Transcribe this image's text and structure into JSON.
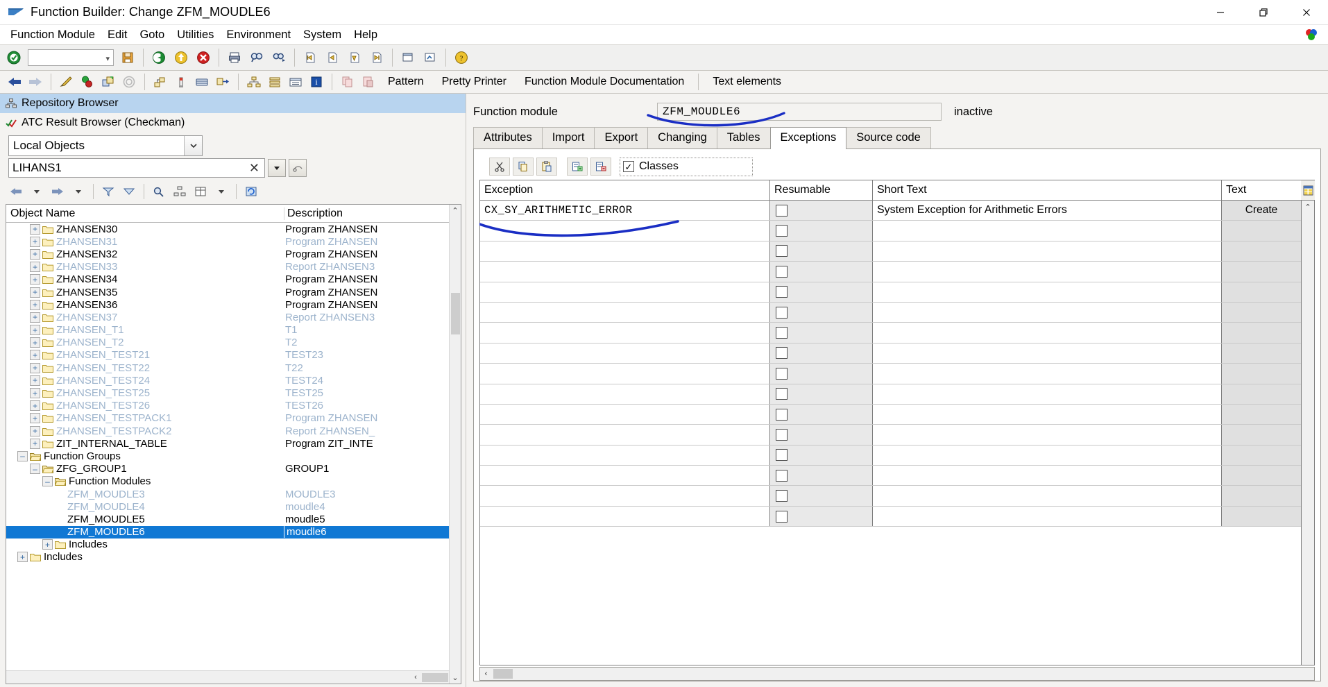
{
  "window": {
    "title": "Function Builder: Change ZFM_MOUDLE6",
    "controls": {
      "minimize": "—",
      "restore": "❐",
      "close": "✕"
    }
  },
  "menubar": {
    "items": [
      {
        "label": "Function Module"
      },
      {
        "label": "Edit"
      },
      {
        "label": "Goto"
      },
      {
        "label": "Utilities"
      },
      {
        "label": "Environment"
      },
      {
        "label": "System"
      },
      {
        "label": "Help"
      }
    ]
  },
  "system_toolbar": {
    "command_field_value": "",
    "icons": [
      {
        "name": "enter-check-icon"
      },
      {
        "name": "save-icon"
      },
      {
        "name": "back-icon"
      },
      {
        "name": "exit-icon"
      },
      {
        "name": "cancel-icon"
      },
      {
        "name": "print-icon"
      },
      {
        "name": "find-icon"
      },
      {
        "name": "find-next-icon"
      },
      {
        "name": "first-page-icon"
      },
      {
        "name": "previous-page-icon"
      },
      {
        "name": "next-page-icon"
      },
      {
        "name": "last-page-icon"
      },
      {
        "name": "create-session-icon"
      },
      {
        "name": "create-shortcut-icon"
      },
      {
        "name": "help-icon"
      }
    ]
  },
  "app_toolbar": {
    "icons": [
      {
        "name": "back-arrow-icon"
      },
      {
        "name": "forward-arrow-icon"
      },
      {
        "name": "check-syntax-icon"
      },
      {
        "name": "activate-icon"
      },
      {
        "name": "display-object-list-icon"
      },
      {
        "name": "trace-icon"
      },
      {
        "name": "where-used-icon"
      },
      {
        "name": "single-test-icon"
      },
      {
        "name": "debugging-icon"
      },
      {
        "name": "navigate-icon"
      },
      {
        "name": "hierarchy-icon"
      },
      {
        "name": "stack-icon"
      },
      {
        "name": "list-icon"
      },
      {
        "name": "info-icon"
      },
      {
        "name": "copy-icon"
      },
      {
        "name": "paste-icon"
      }
    ],
    "buttons": [
      {
        "label": "Pattern"
      },
      {
        "label": "Pretty Printer"
      },
      {
        "label": "Function Module Documentation"
      },
      {
        "label": "Text elements"
      }
    ]
  },
  "left_panel": {
    "repository_browser_title": "Repository Browser",
    "atc_result_browser_title": "ATC Result Browser (Checkman)",
    "object_type_select": {
      "value": "Local Objects"
    },
    "search_field": {
      "value": "LIHANS1",
      "clear": "✕"
    },
    "tree_toolbar_icons": [
      {
        "name": "tree-back-icon"
      },
      {
        "name": "tree-back-dropdown-icon"
      },
      {
        "name": "tree-forward-icon"
      },
      {
        "name": "tree-forward-dropdown-icon"
      },
      {
        "name": "filter-icon"
      },
      {
        "name": "sort-icon"
      },
      {
        "name": "find-tree-icon"
      },
      {
        "name": "hierarchy-tree-icon"
      },
      {
        "name": "settings-grid-icon"
      },
      {
        "name": "settings-dropdown-icon"
      },
      {
        "name": "refresh-icon"
      }
    ],
    "columns": {
      "name": "Object Name",
      "description": "Description"
    },
    "tree_rows": [
      {
        "indent": 1,
        "expander": "+",
        "icon": "folder",
        "name": "ZHANSEN30",
        "desc": "Program ZHANSEN",
        "dim": false,
        "selected": false
      },
      {
        "indent": 1,
        "expander": "+",
        "icon": "folder",
        "name": "ZHANSEN31",
        "desc": "Program ZHANSEN",
        "dim": true,
        "selected": false
      },
      {
        "indent": 1,
        "expander": "+",
        "icon": "folder",
        "name": "ZHANSEN32",
        "desc": "Program ZHANSEN",
        "dim": false,
        "selected": false
      },
      {
        "indent": 1,
        "expander": "+",
        "icon": "folder",
        "name": "ZHANSEN33",
        "desc": "Report ZHANSEN3",
        "dim": true,
        "selected": false
      },
      {
        "indent": 1,
        "expander": "+",
        "icon": "folder",
        "name": "ZHANSEN34",
        "desc": "Program ZHANSEN",
        "dim": false,
        "selected": false
      },
      {
        "indent": 1,
        "expander": "+",
        "icon": "folder",
        "name": "ZHANSEN35",
        "desc": "Program ZHANSEN",
        "dim": false,
        "selected": false
      },
      {
        "indent": 1,
        "expander": "+",
        "icon": "folder",
        "name": "ZHANSEN36",
        "desc": "Program ZHANSEN",
        "dim": false,
        "selected": false
      },
      {
        "indent": 1,
        "expander": "+",
        "icon": "folder",
        "name": "ZHANSEN37",
        "desc": "Report ZHANSEN3",
        "dim": true,
        "selected": false
      },
      {
        "indent": 1,
        "expander": "+",
        "icon": "folder",
        "name": "ZHANSEN_T1",
        "desc": "T1",
        "dim": true,
        "selected": false
      },
      {
        "indent": 1,
        "expander": "+",
        "icon": "folder",
        "name": "ZHANSEN_T2",
        "desc": "T2",
        "dim": true,
        "selected": false
      },
      {
        "indent": 1,
        "expander": "+",
        "icon": "folder",
        "name": "ZHANSEN_TEST21",
        "desc": "TEST23",
        "dim": true,
        "selected": false
      },
      {
        "indent": 1,
        "expander": "+",
        "icon": "folder",
        "name": "ZHANSEN_TEST22",
        "desc": "T22",
        "dim": true,
        "selected": false
      },
      {
        "indent": 1,
        "expander": "+",
        "icon": "folder",
        "name": "ZHANSEN_TEST24",
        "desc": "TEST24",
        "dim": true,
        "selected": false
      },
      {
        "indent": 1,
        "expander": "+",
        "icon": "folder",
        "name": "ZHANSEN_TEST25",
        "desc": "TEST25",
        "dim": true,
        "selected": false
      },
      {
        "indent": 1,
        "expander": "+",
        "icon": "folder",
        "name": "ZHANSEN_TEST26",
        "desc": "TEST26",
        "dim": true,
        "selected": false
      },
      {
        "indent": 1,
        "expander": "+",
        "icon": "folder",
        "name": "ZHANSEN_TESTPACK1",
        "desc": "Program ZHANSEN",
        "dim": true,
        "selected": false
      },
      {
        "indent": 1,
        "expander": "+",
        "icon": "folder",
        "name": "ZHANSEN_TESTPACK2",
        "desc": "Report ZHANSEN_",
        "dim": true,
        "selected": false
      },
      {
        "indent": 1,
        "expander": "+",
        "icon": "folder",
        "name": "ZIT_INTERNAL_TABLE",
        "desc": "Program ZIT_INTE",
        "dim": false,
        "selected": false
      },
      {
        "indent": 0,
        "expander": "–",
        "icon": "openfolder",
        "name": "Function Groups",
        "desc": "",
        "dim": false,
        "selected": false
      },
      {
        "indent": 1,
        "expander": "–",
        "icon": "openfolder",
        "name": "ZFG_GROUP1",
        "desc": "GROUP1",
        "dim": false,
        "selected": false
      },
      {
        "indent": 2,
        "expander": "–",
        "icon": "openfolder",
        "name": "Function Modules",
        "desc": "",
        "dim": false,
        "selected": false
      },
      {
        "indent": 3,
        "expander": "",
        "icon": "none",
        "name": "ZFM_MOUDLE3",
        "desc": "MOUDLE3",
        "dim": true,
        "selected": false
      },
      {
        "indent": 3,
        "expander": "",
        "icon": "none",
        "name": "ZFM_MOUDLE4",
        "desc": "moudle4",
        "dim": true,
        "selected": false
      },
      {
        "indent": 3,
        "expander": "",
        "icon": "none",
        "name": "ZFM_MOUDLE5",
        "desc": "moudle5",
        "dim": false,
        "selected": false
      },
      {
        "indent": 3,
        "expander": "",
        "icon": "none",
        "name": "ZFM_MOUDLE6",
        "desc": "moudle6",
        "dim": false,
        "selected": true
      },
      {
        "indent": 2,
        "expander": "+",
        "icon": "folder",
        "name": "Includes",
        "desc": "",
        "dim": false,
        "selected": false
      },
      {
        "indent": 0,
        "expander": "+",
        "icon": "folder",
        "name": "Includes",
        "desc": "",
        "dim": false,
        "selected": false
      }
    ]
  },
  "right_panel": {
    "function_module_label": "Function module",
    "function_module_name": "ZFM_MOUDLE6",
    "status": "inactive",
    "tabs": [
      {
        "label": "Attributes",
        "active": false
      },
      {
        "label": "Import",
        "active": false
      },
      {
        "label": "Export",
        "active": false
      },
      {
        "label": "Changing",
        "active": false
      },
      {
        "label": "Tables",
        "active": false
      },
      {
        "label": "Exceptions",
        "active": true
      },
      {
        "label": "Source code",
        "active": false
      }
    ],
    "exceptions_toolbar": {
      "icons": [
        {
          "name": "cut-icon"
        },
        {
          "name": "copy-icon"
        },
        {
          "name": "paste-icon"
        },
        {
          "name": "insert-row-icon"
        },
        {
          "name": "delete-row-icon"
        }
      ],
      "classes_checkbox": {
        "label": "Classes",
        "checked": true,
        "mark": "✓"
      }
    },
    "grid": {
      "columns": [
        "Exception",
        "Resumable",
        "Short Text",
        "Text"
      ],
      "rows": [
        {
          "exception": "CX_SY_ARITHMETIC_ERROR",
          "resumable": false,
          "short_text": "System Exception for Arithmetic Errors",
          "text": "Create"
        },
        {
          "exception": "",
          "resumable": false,
          "short_text": "",
          "text": ""
        },
        {
          "exception": "",
          "resumable": false,
          "short_text": "",
          "text": ""
        },
        {
          "exception": "",
          "resumable": false,
          "short_text": "",
          "text": ""
        },
        {
          "exception": "",
          "resumable": false,
          "short_text": "",
          "text": ""
        },
        {
          "exception": "",
          "resumable": false,
          "short_text": "",
          "text": ""
        },
        {
          "exception": "",
          "resumable": false,
          "short_text": "",
          "text": ""
        },
        {
          "exception": "",
          "resumable": false,
          "short_text": "",
          "text": ""
        },
        {
          "exception": "",
          "resumable": false,
          "short_text": "",
          "text": ""
        },
        {
          "exception": "",
          "resumable": false,
          "short_text": "",
          "text": ""
        },
        {
          "exception": "",
          "resumable": false,
          "short_text": "",
          "text": ""
        },
        {
          "exception": "",
          "resumable": false,
          "short_text": "",
          "text": ""
        },
        {
          "exception": "",
          "resumable": false,
          "short_text": "",
          "text": ""
        },
        {
          "exception": "",
          "resumable": false,
          "short_text": "",
          "text": ""
        },
        {
          "exception": "",
          "resumable": false,
          "short_text": "",
          "text": ""
        },
        {
          "exception": "",
          "resumable": false,
          "short_text": "",
          "text": ""
        }
      ]
    }
  },
  "colors": {
    "accent_blue": "#1078d4",
    "panel_header_blue": "#b8d4ef",
    "annotation_blue": "#1a2ec4",
    "toolbar_bg": "#f0f0ef",
    "dim_text": "#9cb3cc"
  }
}
